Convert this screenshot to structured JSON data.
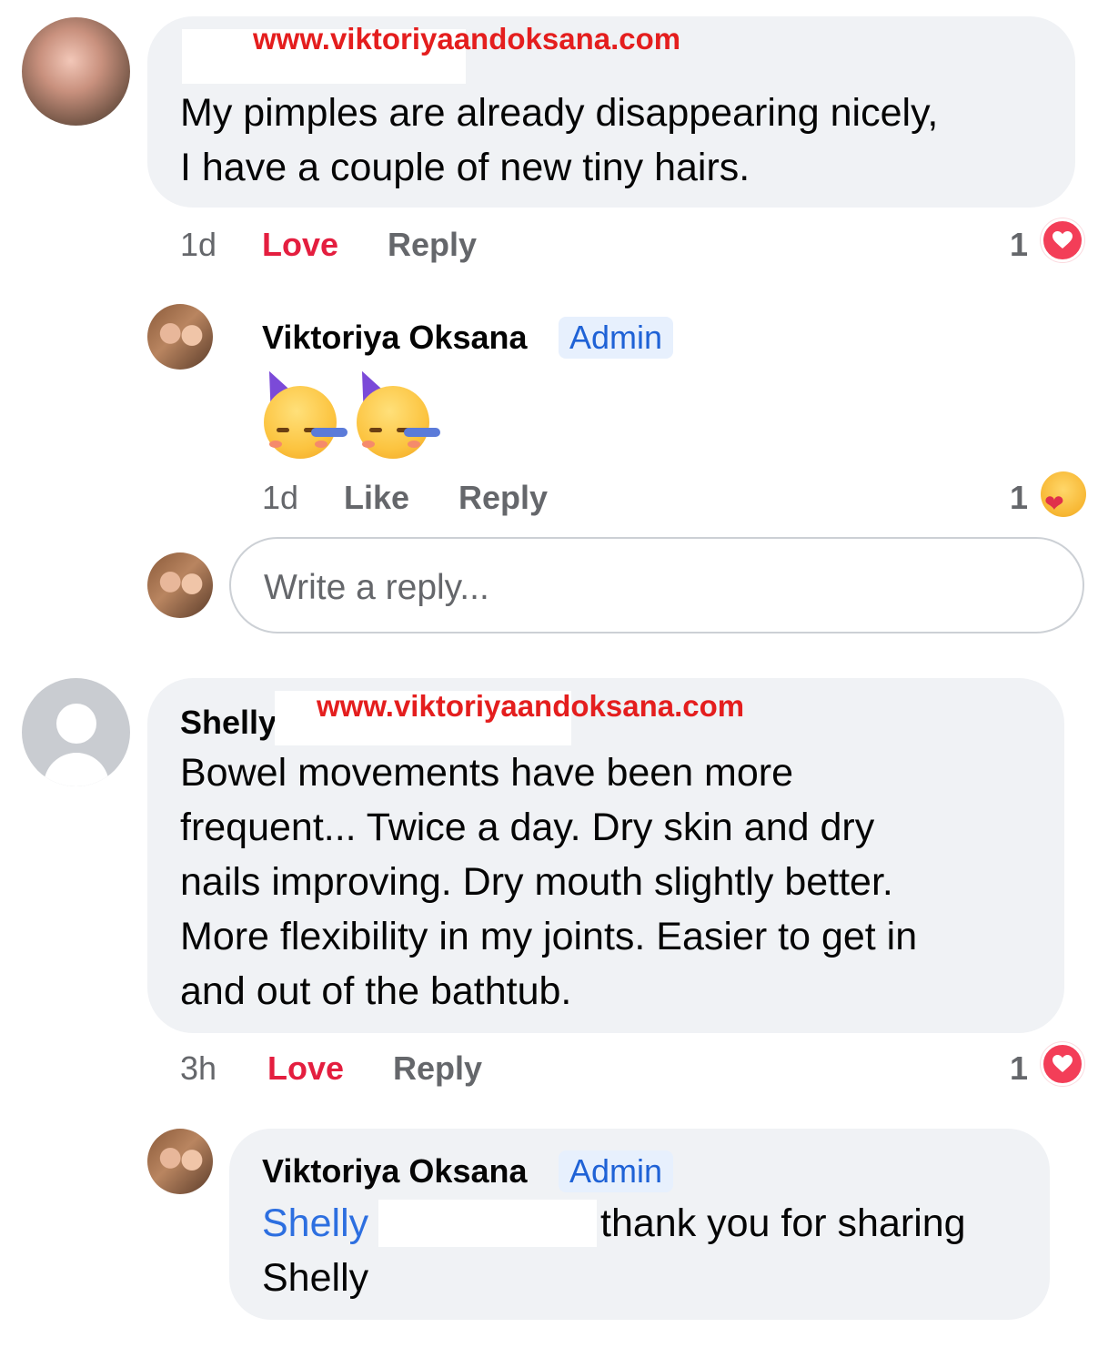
{
  "comments": [
    {
      "watermark": "www.viktoriyaandoksana.com",
      "text_lines": [
        "My pimples are already disappearing nicely,",
        "I have a couple of new tiny hairs."
      ],
      "time": "1d",
      "love_label": "Love",
      "reply_label": "Reply",
      "reaction_count": "1",
      "reaction_icon": "heart-icon",
      "reply": {
        "author": "Viktoriya Oksana",
        "badge": "Admin",
        "emoji": [
          "party-face-icon",
          "party-face-icon"
        ],
        "time": "1d",
        "like_label": "Like",
        "reply_label": "Reply",
        "reaction_count": "1",
        "reaction_icon": "care-hug-icon"
      }
    },
    {
      "author_visible": "Shelly",
      "watermark": "www.viktoriyaandoksana.com",
      "text_lines": [
        "Bowel movements have been more",
        "frequent... Twice a day.  Dry skin and dry",
        "nails improving. Dry mouth slightly better.",
        "More flexibility in my joints.  Easier to get in",
        "and out of the bathtub."
      ],
      "time": "3h",
      "love_label": "Love",
      "reply_label": "Reply",
      "reaction_count": "1",
      "reaction_icon": "heart-icon",
      "reply": {
        "author": "Viktoriya Oksana",
        "badge": "Admin",
        "mention": "Shelly",
        "text_after_mention": "thank you for sharing",
        "text_line2": "Shelly"
      }
    }
  ],
  "reply_box": {
    "placeholder": "Write a reply..."
  },
  "colors": {
    "bubble_bg": "#f0f2f5",
    "love_red": "#e41e3f",
    "watermark_red": "#e41e1e",
    "admin_blue": "#1f62d6",
    "mention_blue": "#2d6fe0",
    "meta_gray": "#65676b"
  }
}
